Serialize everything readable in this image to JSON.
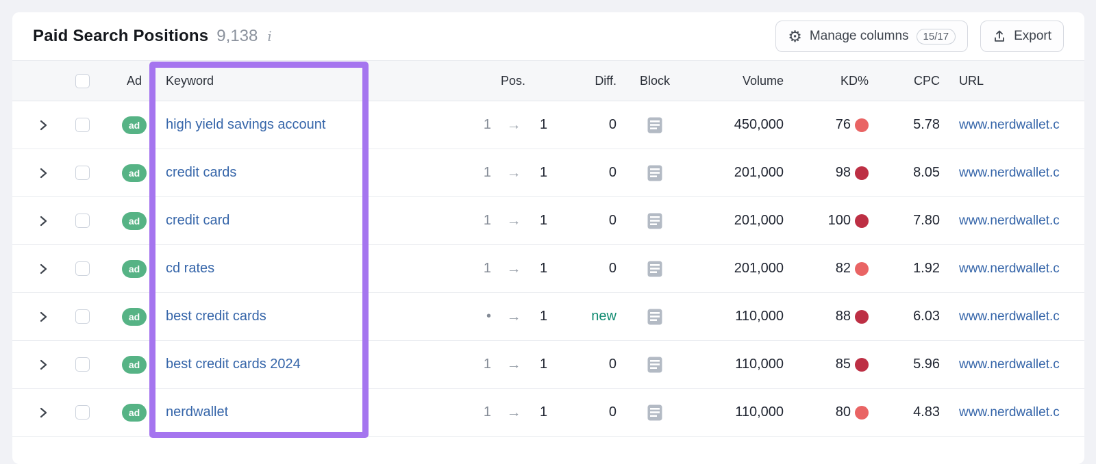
{
  "header": {
    "title": "Paid Search Positions",
    "count": "9,138",
    "info_icon": "i"
  },
  "toolbar": {
    "manage_columns_label": "Manage columns",
    "columns_badge": "15/17",
    "export_label": "Export"
  },
  "icons": {
    "gear": "⚙",
    "arrow_right": "→"
  },
  "table": {
    "ad_badge": "ad",
    "columns": {
      "ad": "Ad",
      "keyword": "Keyword",
      "pos": "Pos.",
      "diff": "Diff.",
      "block": "Block",
      "volume": "Volume",
      "kd": "KD%",
      "cpc": "CPC",
      "url": "URL"
    },
    "rows": [
      {
        "keyword": "high yield savings account",
        "pos_old": "1",
        "pos_new": "1",
        "diff": "0",
        "volume": "450,000",
        "kd": "76",
        "kd_level": "hard",
        "cpc": "5.78",
        "url": "www.nerdwallet.c"
      },
      {
        "keyword": "credit cards",
        "pos_old": "1",
        "pos_new": "1",
        "diff": "0",
        "volume": "201,000",
        "kd": "98",
        "kd_level": "very-hard",
        "cpc": "8.05",
        "url": "www.nerdwallet.c"
      },
      {
        "keyword": "credit card",
        "pos_old": "1",
        "pos_new": "1",
        "diff": "0",
        "volume": "201,000",
        "kd": "100",
        "kd_level": "very-hard",
        "cpc": "7.80",
        "url": "www.nerdwallet.c"
      },
      {
        "keyword": "cd rates",
        "pos_old": "1",
        "pos_new": "1",
        "diff": "0",
        "volume": "201,000",
        "kd": "82",
        "kd_level": "hard",
        "cpc": "1.92",
        "url": "www.nerdwallet.c"
      },
      {
        "keyword": "best credit cards",
        "pos_old": "•",
        "pos_new": "1",
        "diff": "new",
        "volume": "110,000",
        "kd": "88",
        "kd_level": "very-hard",
        "cpc": "6.03",
        "url": "www.nerdwallet.c"
      },
      {
        "keyword": "best credit cards 2024",
        "pos_old": "1",
        "pos_new": "1",
        "diff": "0",
        "volume": "110,000",
        "kd": "85",
        "kd_level": "very-hard",
        "cpc": "5.96",
        "url": "www.nerdwallet.c"
      },
      {
        "keyword": "nerdwallet",
        "pos_old": "1",
        "pos_new": "1",
        "diff": "0",
        "volume": "110,000",
        "kd": "80",
        "kd_level": "hard",
        "cpc": "4.83",
        "url": "www.nerdwallet.c"
      }
    ]
  },
  "colors": {
    "accent_purple": "#a575ef",
    "kd_very_hard": "#bd2f44",
    "kd_hard": "#e96464",
    "ad_green": "#56b385",
    "link_blue": "#3565a9",
    "new_green": "#0f8a70"
  }
}
